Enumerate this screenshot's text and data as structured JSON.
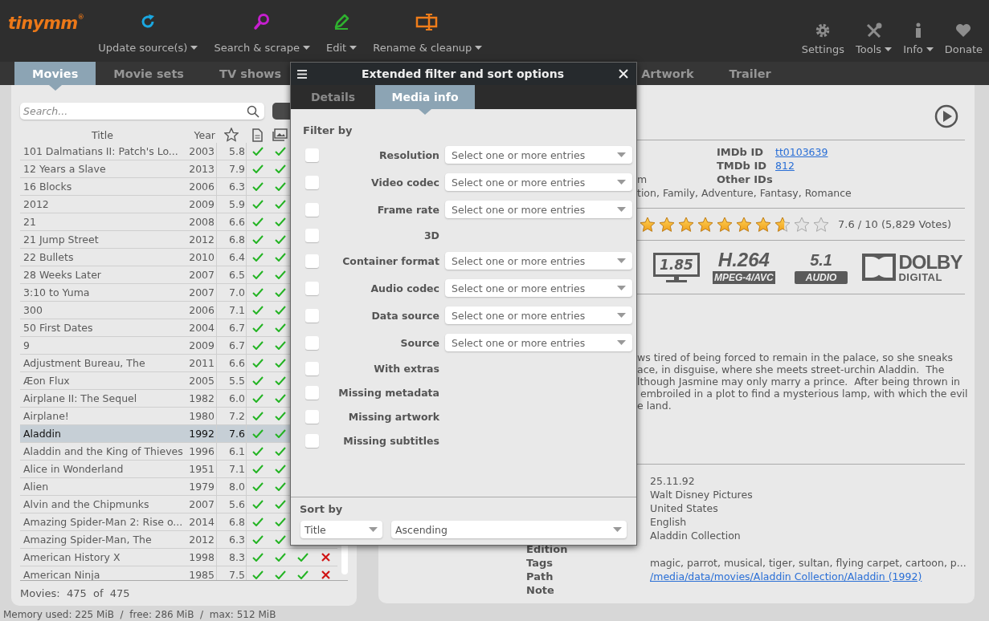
{
  "app": {
    "logo": "tinymm",
    "logo_mark": "®"
  },
  "toolbar_left": [
    {
      "label": "Update source(s)",
      "has_menu": true
    },
    {
      "label": "Search & scrape",
      "has_menu": true
    },
    {
      "label": "Edit",
      "has_menu": true
    },
    {
      "label": "Rename & cleanup",
      "has_menu": true
    }
  ],
  "toolbar_right": [
    {
      "label": "Settings",
      "has_menu": false
    },
    {
      "label": "Tools",
      "has_menu": true
    },
    {
      "label": "Info",
      "has_menu": true
    },
    {
      "label": "Donate",
      "has_menu": false
    }
  ],
  "tabs": [
    {
      "label": "Movies",
      "selected": true
    },
    {
      "label": "Movie sets",
      "selected": false
    },
    {
      "label": "TV shows",
      "selected": false
    }
  ],
  "detail_tabs": [
    {
      "label": "Artwork",
      "selected": false
    },
    {
      "label": "Trailer",
      "selected": false
    }
  ],
  "movie_list": {
    "search": {
      "placeholder": "Search..."
    },
    "columns": [
      "Title",
      "Year"
    ],
    "rows": [
      {
        "title": "101 Dalmatians II: Patch's Lo...",
        "year": "2003",
        "rating": "5.8",
        "selected": false,
        "flags": [
          true,
          true
        ]
      },
      {
        "title": "12 Years a Slave",
        "year": "2013",
        "rating": "7.9",
        "selected": false,
        "flags": [
          true,
          true
        ]
      },
      {
        "title": "16 Blocks",
        "year": "2006",
        "rating": "6.3",
        "selected": false,
        "flags": [
          true,
          true
        ]
      },
      {
        "title": "2012",
        "year": "2009",
        "rating": "5.9",
        "selected": false,
        "flags": [
          true,
          true
        ]
      },
      {
        "title": "21",
        "year": "2008",
        "rating": "6.6",
        "selected": false,
        "flags": [
          true,
          true
        ]
      },
      {
        "title": "21 Jump Street",
        "year": "2012",
        "rating": "6.8",
        "selected": false,
        "flags": [
          true,
          true
        ]
      },
      {
        "title": "22 Bullets",
        "year": "2010",
        "rating": "6.4",
        "selected": false,
        "flags": [
          true,
          true
        ]
      },
      {
        "title": "28 Weeks Later",
        "year": "2007",
        "rating": "6.5",
        "selected": false,
        "flags": [
          true,
          true
        ]
      },
      {
        "title": "3:10 to Yuma",
        "year": "2007",
        "rating": "7.0",
        "selected": false,
        "flags": [
          true,
          true
        ]
      },
      {
        "title": "300",
        "year": "2006",
        "rating": "7.1",
        "selected": false,
        "flags": [
          true,
          true
        ]
      },
      {
        "title": "50 First Dates",
        "year": "2004",
        "rating": "6.7",
        "selected": false,
        "flags": [
          true,
          true
        ]
      },
      {
        "title": "9",
        "year": "2009",
        "rating": "6.7",
        "selected": false,
        "flags": [
          true,
          true
        ]
      },
      {
        "title": "Adjustment Bureau, The",
        "year": "2011",
        "rating": "6.6",
        "selected": false,
        "flags": [
          true,
          true
        ]
      },
      {
        "title": "Æon Flux",
        "year": "2005",
        "rating": "5.5",
        "selected": false,
        "flags": [
          true,
          true
        ]
      },
      {
        "title": "Airplane II: The Sequel",
        "year": "1982",
        "rating": "6.0",
        "selected": false,
        "flags": [
          true,
          true
        ]
      },
      {
        "title": "Airplane!",
        "year": "1980",
        "rating": "7.2",
        "selected": false,
        "flags": [
          true,
          true
        ]
      },
      {
        "title": "Aladdin",
        "year": "1992",
        "rating": "7.6",
        "selected": true,
        "flags": [
          true,
          true
        ]
      },
      {
        "title": "Aladdin and the King of Thieves",
        "year": "1996",
        "rating": "6.1",
        "selected": false,
        "flags": [
          true,
          true
        ]
      },
      {
        "title": "Alice in Wonderland",
        "year": "1951",
        "rating": "7.1",
        "selected": false,
        "flags": [
          true,
          true
        ]
      },
      {
        "title": "Alien",
        "year": "1979",
        "rating": "8.0",
        "selected": false,
        "flags": [
          true,
          true
        ]
      },
      {
        "title": "Alvin and the Chipmunks",
        "year": "2007",
        "rating": "5.6",
        "selected": false,
        "flags": [
          true,
          true
        ]
      },
      {
        "title": "Amazing Spider-Man 2: Rise o...",
        "year": "2014",
        "rating": "6.8",
        "selected": false,
        "flags": [
          true,
          true
        ]
      },
      {
        "title": "Amazing Spider-Man, The",
        "year": "2012",
        "rating": "6.3",
        "selected": false,
        "flags": [
          true,
          true
        ]
      },
      {
        "title": "American History X",
        "year": "1998",
        "rating": "8.3",
        "selected": false,
        "flags": [
          true,
          true,
          true,
          false
        ]
      },
      {
        "title": "American Ninja",
        "year": "1985",
        "rating": "7.5",
        "selected": false,
        "flags": [
          true,
          true,
          true,
          false
        ]
      }
    ],
    "count_label": "Movies:",
    "count": "475",
    "of": "of",
    "total": "475"
  },
  "details": {
    "ids": [
      {
        "label": "IMDb ID",
        "value": "tt0103639",
        "kind": "link"
      },
      {
        "label": "TMDb ID",
        "value": "812",
        "kind": "link"
      },
      {
        "label": "Other IDs"
      }
    ],
    "fragment_1": "m",
    "genres": "tion, Family, Adventure, Fantasy, Romance",
    "stars": 7.6,
    "rating_text": "7.6 / 10  (5,829 Votes)",
    "media_badges": [
      {
        "kind": "aspect",
        "text": "1.85"
      },
      {
        "kind": "codec",
        "text": "H.264",
        "sub": "MPEG-4/AVC"
      },
      {
        "kind": "channels",
        "text": "5.1",
        "sub": "AUDIO"
      },
      {
        "kind": "dolby",
        "text": "DOLBY",
        "sub": "DIGITAL"
      }
    ],
    "plot_lines": [
      "ws tired of being forced to remain in the palace, so she sneaks",
      "ace, in disguise, where she meets street-urchin Aladdin.  The",
      "lthough Jasmine may only marry a prince.  After being thrown in",
      " embroiled in a plot to find a mysterious lamp, with which the evil",
      "e land."
    ],
    "fields": [
      {
        "value": "25.11.92"
      },
      {
        "value": "Walt Disney Pictures"
      },
      {
        "value": "United States"
      },
      {
        "value": "English"
      },
      {
        "value": "Aladdin Collection"
      },
      {
        "label": "Edition"
      },
      {
        "label": "Tags",
        "value": "magic, parrot, musical, tiger, sultan, flying carpet, cartoon, p..."
      },
      {
        "label": "Path",
        "value": "/media/data/movies/Aladdin Collection/Aladdin (1992)",
        "kind": "link"
      },
      {
        "label": "Note"
      }
    ]
  },
  "dialog": {
    "title": "Extended filter and sort options",
    "tabs": [
      {
        "label": "Details",
        "selected": false
      },
      {
        "label": "Media info",
        "selected": true
      }
    ],
    "filter_heading": "Filter by",
    "filters": [
      {
        "label": "Resolution",
        "kind": "select",
        "checked": false,
        "placeholder": "Select one or more entries"
      },
      {
        "label": "Video codec",
        "kind": "select",
        "checked": false,
        "placeholder": "Select one or more entries"
      },
      {
        "label": "Frame rate",
        "kind": "select",
        "checked": false,
        "placeholder": "Select one or more entries"
      },
      {
        "label": "3D",
        "kind": "checkbox",
        "checked": false
      },
      {
        "label": "Container format",
        "kind": "select",
        "checked": false,
        "placeholder": "Select one or more entries"
      },
      {
        "label": "Audio codec",
        "kind": "select",
        "checked": false,
        "placeholder": "Select one or more entries"
      },
      {
        "label": "Data source",
        "kind": "select",
        "checked": false,
        "placeholder": "Select one or more entries"
      },
      {
        "label": "Source",
        "kind": "select",
        "checked": false,
        "placeholder": "Select one or more entries"
      },
      {
        "label": "With extras",
        "kind": "checkbox",
        "checked": false
      },
      {
        "label": "Missing metadata",
        "kind": "checkbox",
        "checked": false
      },
      {
        "label": "Missing artwork",
        "kind": "checkbox",
        "checked": false
      },
      {
        "label": "Missing subtitles",
        "kind": "checkbox",
        "checked": false
      }
    ],
    "sort_heading": "Sort by",
    "sort_field": "Title",
    "sort_order": "Ascending"
  },
  "status_bar": "Memory used: 225 MiB  /  free: 286 MiB  /  max: 512 MiB"
}
